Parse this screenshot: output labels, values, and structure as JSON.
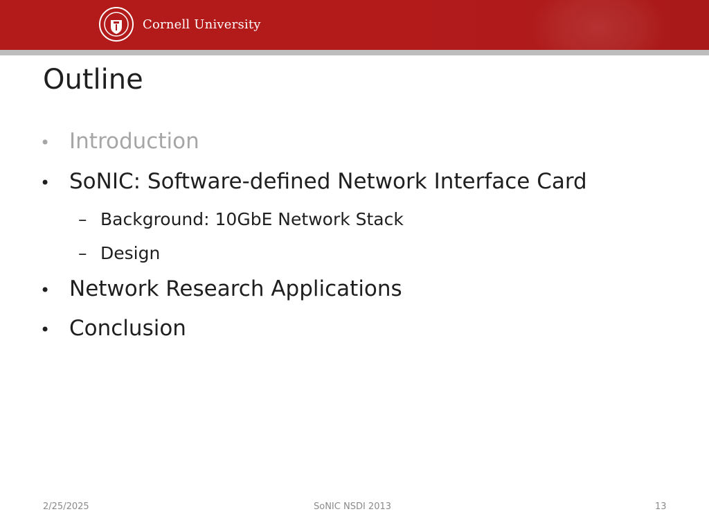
{
  "header": {
    "brand_name": "Cornell University",
    "bar_color": "#b31b1b",
    "stripe_color": "#bdbdbd"
  },
  "slide": {
    "title": "Outline",
    "bullets": [
      {
        "marker": "•",
        "text": "Introduction",
        "level": 1,
        "dimmed": true
      },
      {
        "marker": "•",
        "text": "SoNIC: Software-defined Network Interface Card",
        "level": 1,
        "dimmed": false
      },
      {
        "marker": "–",
        "text": "Background: 10GbE Network Stack",
        "level": 2,
        "dimmed": false
      },
      {
        "marker": "–",
        "text": "Design",
        "level": 2,
        "dimmed": false
      },
      {
        "marker": "•",
        "text": "Network Research Applications",
        "level": 1,
        "dimmed": false
      },
      {
        "marker": "•",
        "text": "Conclusion",
        "level": 1,
        "dimmed": false
      }
    ]
  },
  "footer": {
    "date": "2/25/2025",
    "center": "SoNIC NSDI 2013",
    "page_number": "13"
  }
}
